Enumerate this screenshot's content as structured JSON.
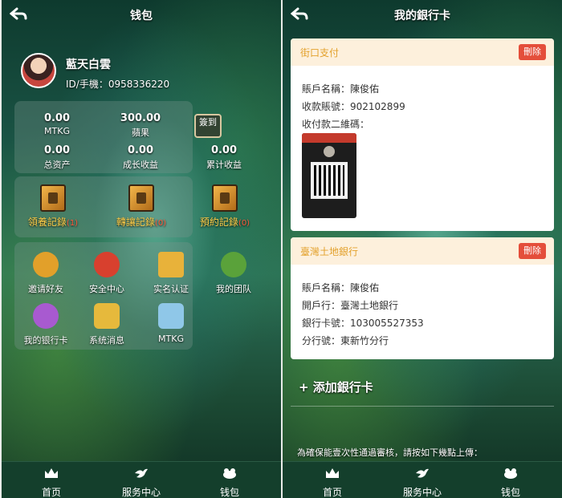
{
  "left": {
    "title": "钱包",
    "user": {
      "name": "藍天白雲",
      "id_phone": "ID/手機：0958336220"
    },
    "stats": [
      {
        "value": "0.00",
        "label": "MTKG"
      },
      {
        "value": "300.00",
        "label": "蘋果"
      },
      {
        "value": "0.00",
        "label": "总资产"
      },
      {
        "value": "0.00",
        "label": "成长收益"
      },
      {
        "value": "0.00",
        "label": "累计收益"
      }
    ],
    "signin_label": "簽到",
    "records": [
      {
        "label": "領養記錄",
        "badge": "(1)"
      },
      {
        "label": "轉讓記錄",
        "badge": "(0)"
      },
      {
        "label": "預約記錄",
        "badge": "(0)"
      }
    ],
    "menu": [
      {
        "label": "邀请好友",
        "icon": "gear-flower-icon",
        "color": "#e2a02a"
      },
      {
        "label": "安全中心",
        "icon": "red-hood-icon",
        "color": "#d8402e"
      },
      {
        "label": "实名认证",
        "icon": "castle-icon",
        "color": "#e8b23a"
      },
      {
        "label": "我的团队",
        "icon": "frog-icon",
        "color": "#5aa23a"
      },
      {
        "label": "我的银行卡",
        "icon": "potion-icon",
        "color": "#a85ad0"
      },
      {
        "label": "系统消息",
        "icon": "lamp-icon",
        "color": "#e6b93c"
      },
      {
        "label": "MTKG",
        "icon": "glass-slipper-icon",
        "color": "#8fc7e8"
      }
    ]
  },
  "right": {
    "title": "我的銀行卡",
    "cards": [
      {
        "name": "街口支付",
        "delete_label": "刪除",
        "rows": [
          "賬戶名稱：陳俊佑",
          "收款賬號：902102899",
          "收付款二維碼："
        ]
      },
      {
        "name": "臺灣土地銀行",
        "delete_label": "刪除",
        "rows": [
          "賬戶名稱：陳俊佑",
          "開戶行：臺灣土地銀行",
          "銀行卡號：103005527353",
          "分行號：東新竹分行"
        ]
      }
    ],
    "add_bank_label": "+ 添加銀行卡",
    "note": "為確保能壹次性通過審核，請按如下幾點上傳："
  },
  "tabs": [
    {
      "label": "首页",
      "icon": "crown-icon"
    },
    {
      "label": "服务中心",
      "icon": "bird-icon"
    },
    {
      "label": "钱包",
      "icon": "frog-icon"
    }
  ]
}
